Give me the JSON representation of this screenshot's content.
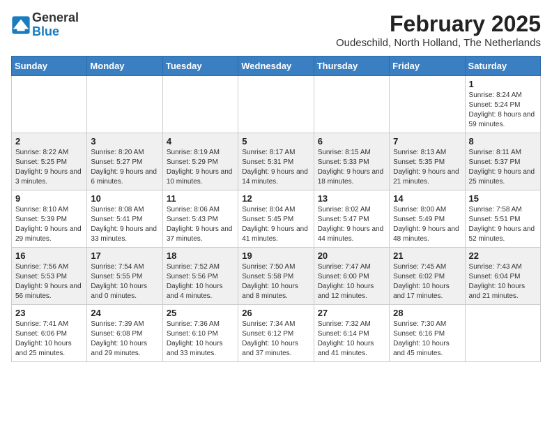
{
  "header": {
    "logo_general": "General",
    "logo_blue": "Blue",
    "title": "February 2025",
    "subtitle": "Oudeschild, North Holland, The Netherlands"
  },
  "weekdays": [
    "Sunday",
    "Monday",
    "Tuesday",
    "Wednesday",
    "Thursday",
    "Friday",
    "Saturday"
  ],
  "weeks": [
    [
      {
        "day": "",
        "info": ""
      },
      {
        "day": "",
        "info": ""
      },
      {
        "day": "",
        "info": ""
      },
      {
        "day": "",
        "info": ""
      },
      {
        "day": "",
        "info": ""
      },
      {
        "day": "",
        "info": ""
      },
      {
        "day": "1",
        "info": "Sunrise: 8:24 AM\nSunset: 5:24 PM\nDaylight: 8 hours\nand 59 minutes."
      }
    ],
    [
      {
        "day": "2",
        "info": "Sunrise: 8:22 AM\nSunset: 5:25 PM\nDaylight: 9 hours\nand 3 minutes."
      },
      {
        "day": "3",
        "info": "Sunrise: 8:20 AM\nSunset: 5:27 PM\nDaylight: 9 hours\nand 6 minutes."
      },
      {
        "day": "4",
        "info": "Sunrise: 8:19 AM\nSunset: 5:29 PM\nDaylight: 9 hours\nand 10 minutes."
      },
      {
        "day": "5",
        "info": "Sunrise: 8:17 AM\nSunset: 5:31 PM\nDaylight: 9 hours\nand 14 minutes."
      },
      {
        "day": "6",
        "info": "Sunrise: 8:15 AM\nSunset: 5:33 PM\nDaylight: 9 hours\nand 18 minutes."
      },
      {
        "day": "7",
        "info": "Sunrise: 8:13 AM\nSunset: 5:35 PM\nDaylight: 9 hours\nand 21 minutes."
      },
      {
        "day": "8",
        "info": "Sunrise: 8:11 AM\nSunset: 5:37 PM\nDaylight: 9 hours\nand 25 minutes."
      }
    ],
    [
      {
        "day": "9",
        "info": "Sunrise: 8:10 AM\nSunset: 5:39 PM\nDaylight: 9 hours\nand 29 minutes."
      },
      {
        "day": "10",
        "info": "Sunrise: 8:08 AM\nSunset: 5:41 PM\nDaylight: 9 hours\nand 33 minutes."
      },
      {
        "day": "11",
        "info": "Sunrise: 8:06 AM\nSunset: 5:43 PM\nDaylight: 9 hours\nand 37 minutes."
      },
      {
        "day": "12",
        "info": "Sunrise: 8:04 AM\nSunset: 5:45 PM\nDaylight: 9 hours\nand 41 minutes."
      },
      {
        "day": "13",
        "info": "Sunrise: 8:02 AM\nSunset: 5:47 PM\nDaylight: 9 hours\nand 44 minutes."
      },
      {
        "day": "14",
        "info": "Sunrise: 8:00 AM\nSunset: 5:49 PM\nDaylight: 9 hours\nand 48 minutes."
      },
      {
        "day": "15",
        "info": "Sunrise: 7:58 AM\nSunset: 5:51 PM\nDaylight: 9 hours\nand 52 minutes."
      }
    ],
    [
      {
        "day": "16",
        "info": "Sunrise: 7:56 AM\nSunset: 5:53 PM\nDaylight: 9 hours\nand 56 minutes."
      },
      {
        "day": "17",
        "info": "Sunrise: 7:54 AM\nSunset: 5:55 PM\nDaylight: 10 hours\nand 0 minutes."
      },
      {
        "day": "18",
        "info": "Sunrise: 7:52 AM\nSunset: 5:56 PM\nDaylight: 10 hours\nand 4 minutes."
      },
      {
        "day": "19",
        "info": "Sunrise: 7:50 AM\nSunset: 5:58 PM\nDaylight: 10 hours\nand 8 minutes."
      },
      {
        "day": "20",
        "info": "Sunrise: 7:47 AM\nSunset: 6:00 PM\nDaylight: 10 hours\nand 12 minutes."
      },
      {
        "day": "21",
        "info": "Sunrise: 7:45 AM\nSunset: 6:02 PM\nDaylight: 10 hours\nand 17 minutes."
      },
      {
        "day": "22",
        "info": "Sunrise: 7:43 AM\nSunset: 6:04 PM\nDaylight: 10 hours\nand 21 minutes."
      }
    ],
    [
      {
        "day": "23",
        "info": "Sunrise: 7:41 AM\nSunset: 6:06 PM\nDaylight: 10 hours\nand 25 minutes."
      },
      {
        "day": "24",
        "info": "Sunrise: 7:39 AM\nSunset: 6:08 PM\nDaylight: 10 hours\nand 29 minutes."
      },
      {
        "day": "25",
        "info": "Sunrise: 7:36 AM\nSunset: 6:10 PM\nDaylight: 10 hours\nand 33 minutes."
      },
      {
        "day": "26",
        "info": "Sunrise: 7:34 AM\nSunset: 6:12 PM\nDaylight: 10 hours\nand 37 minutes."
      },
      {
        "day": "27",
        "info": "Sunrise: 7:32 AM\nSunset: 6:14 PM\nDaylight: 10 hours\nand 41 minutes."
      },
      {
        "day": "28",
        "info": "Sunrise: 7:30 AM\nSunset: 6:16 PM\nDaylight: 10 hours\nand 45 minutes."
      },
      {
        "day": "",
        "info": ""
      }
    ]
  ]
}
